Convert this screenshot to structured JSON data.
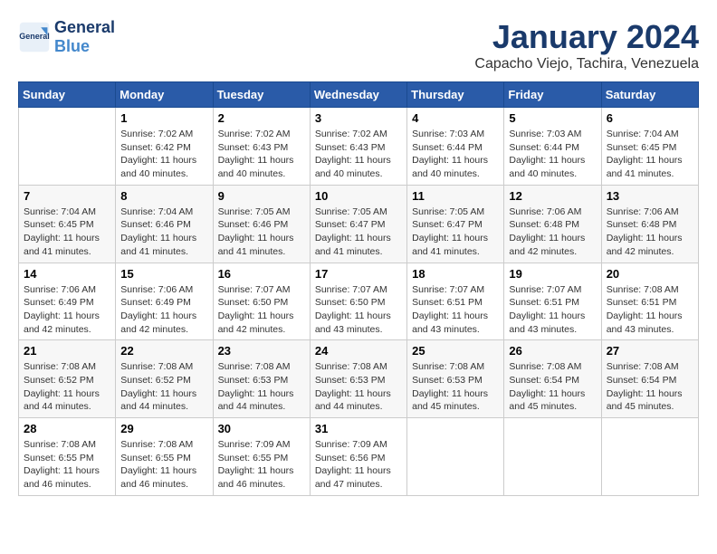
{
  "header": {
    "logo_general": "General",
    "logo_blue": "Blue",
    "month_title": "January 2024",
    "location": "Capacho Viejo, Tachira, Venezuela"
  },
  "calendar": {
    "days_of_week": [
      "Sunday",
      "Monday",
      "Tuesday",
      "Wednesday",
      "Thursday",
      "Friday",
      "Saturday"
    ],
    "weeks": [
      [
        {
          "day": "",
          "info": ""
        },
        {
          "day": "1",
          "info": "Sunrise: 7:02 AM\nSunset: 6:42 PM\nDaylight: 11 hours\nand 40 minutes."
        },
        {
          "day": "2",
          "info": "Sunrise: 7:02 AM\nSunset: 6:43 PM\nDaylight: 11 hours\nand 40 minutes."
        },
        {
          "day": "3",
          "info": "Sunrise: 7:02 AM\nSunset: 6:43 PM\nDaylight: 11 hours\nand 40 minutes."
        },
        {
          "day": "4",
          "info": "Sunrise: 7:03 AM\nSunset: 6:44 PM\nDaylight: 11 hours\nand 40 minutes."
        },
        {
          "day": "5",
          "info": "Sunrise: 7:03 AM\nSunset: 6:44 PM\nDaylight: 11 hours\nand 40 minutes."
        },
        {
          "day": "6",
          "info": "Sunrise: 7:04 AM\nSunset: 6:45 PM\nDaylight: 11 hours\nand 41 minutes."
        }
      ],
      [
        {
          "day": "7",
          "info": "Sunrise: 7:04 AM\nSunset: 6:45 PM\nDaylight: 11 hours\nand 41 minutes."
        },
        {
          "day": "8",
          "info": "Sunrise: 7:04 AM\nSunset: 6:46 PM\nDaylight: 11 hours\nand 41 minutes."
        },
        {
          "day": "9",
          "info": "Sunrise: 7:05 AM\nSunset: 6:46 PM\nDaylight: 11 hours\nand 41 minutes."
        },
        {
          "day": "10",
          "info": "Sunrise: 7:05 AM\nSunset: 6:47 PM\nDaylight: 11 hours\nand 41 minutes."
        },
        {
          "day": "11",
          "info": "Sunrise: 7:05 AM\nSunset: 6:47 PM\nDaylight: 11 hours\nand 41 minutes."
        },
        {
          "day": "12",
          "info": "Sunrise: 7:06 AM\nSunset: 6:48 PM\nDaylight: 11 hours\nand 42 minutes."
        },
        {
          "day": "13",
          "info": "Sunrise: 7:06 AM\nSunset: 6:48 PM\nDaylight: 11 hours\nand 42 minutes."
        }
      ],
      [
        {
          "day": "14",
          "info": "Sunrise: 7:06 AM\nSunset: 6:49 PM\nDaylight: 11 hours\nand 42 minutes."
        },
        {
          "day": "15",
          "info": "Sunrise: 7:06 AM\nSunset: 6:49 PM\nDaylight: 11 hours\nand 42 minutes."
        },
        {
          "day": "16",
          "info": "Sunrise: 7:07 AM\nSunset: 6:50 PM\nDaylight: 11 hours\nand 42 minutes."
        },
        {
          "day": "17",
          "info": "Sunrise: 7:07 AM\nSunset: 6:50 PM\nDaylight: 11 hours\nand 43 minutes."
        },
        {
          "day": "18",
          "info": "Sunrise: 7:07 AM\nSunset: 6:51 PM\nDaylight: 11 hours\nand 43 minutes."
        },
        {
          "day": "19",
          "info": "Sunrise: 7:07 AM\nSunset: 6:51 PM\nDaylight: 11 hours\nand 43 minutes."
        },
        {
          "day": "20",
          "info": "Sunrise: 7:08 AM\nSunset: 6:51 PM\nDaylight: 11 hours\nand 43 minutes."
        }
      ],
      [
        {
          "day": "21",
          "info": "Sunrise: 7:08 AM\nSunset: 6:52 PM\nDaylight: 11 hours\nand 44 minutes."
        },
        {
          "day": "22",
          "info": "Sunrise: 7:08 AM\nSunset: 6:52 PM\nDaylight: 11 hours\nand 44 minutes."
        },
        {
          "day": "23",
          "info": "Sunrise: 7:08 AM\nSunset: 6:53 PM\nDaylight: 11 hours\nand 44 minutes."
        },
        {
          "day": "24",
          "info": "Sunrise: 7:08 AM\nSunset: 6:53 PM\nDaylight: 11 hours\nand 44 minutes."
        },
        {
          "day": "25",
          "info": "Sunrise: 7:08 AM\nSunset: 6:53 PM\nDaylight: 11 hours\nand 45 minutes."
        },
        {
          "day": "26",
          "info": "Sunrise: 7:08 AM\nSunset: 6:54 PM\nDaylight: 11 hours\nand 45 minutes."
        },
        {
          "day": "27",
          "info": "Sunrise: 7:08 AM\nSunset: 6:54 PM\nDaylight: 11 hours\nand 45 minutes."
        }
      ],
      [
        {
          "day": "28",
          "info": "Sunrise: 7:08 AM\nSunset: 6:55 PM\nDaylight: 11 hours\nand 46 minutes."
        },
        {
          "day": "29",
          "info": "Sunrise: 7:08 AM\nSunset: 6:55 PM\nDaylight: 11 hours\nand 46 minutes."
        },
        {
          "day": "30",
          "info": "Sunrise: 7:09 AM\nSunset: 6:55 PM\nDaylight: 11 hours\nand 46 minutes."
        },
        {
          "day": "31",
          "info": "Sunrise: 7:09 AM\nSunset: 6:56 PM\nDaylight: 11 hours\nand 47 minutes."
        },
        {
          "day": "",
          "info": ""
        },
        {
          "day": "",
          "info": ""
        },
        {
          "day": "",
          "info": ""
        }
      ]
    ]
  }
}
